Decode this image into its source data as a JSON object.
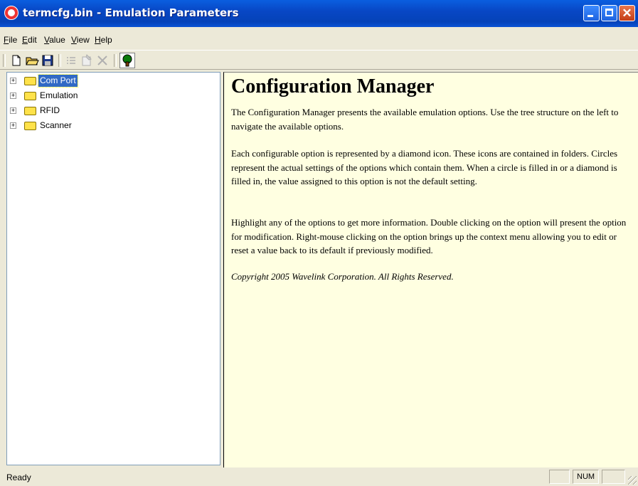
{
  "window": {
    "title": "termcfg.bin - Emulation Parameters",
    "close_glyph": "✕"
  },
  "menu": [
    "File",
    "Edit",
    "Value",
    "View",
    "Help"
  ],
  "toolbar": {
    "buttons": [
      "new-icon",
      "open-icon",
      "save-icon",
      "list-icon",
      "properties-icon",
      "delete-icon",
      "tree-icon"
    ]
  },
  "tree": {
    "expander_glyph": "+",
    "items": [
      {
        "label": "Com Port",
        "selected": true
      },
      {
        "label": "Emulation"
      },
      {
        "label": "RFID"
      },
      {
        "label": "Scanner"
      }
    ]
  },
  "content": {
    "heading": "Configuration Manager",
    "para1": "The Configuration Manager presents the available emulation options.  Use the tree structure on the left to navigate the available options.",
    "para2": "Each configurable option is represented by a diamond icon.  These icons are contained in folders.  Circles represent the actual settings of the options which contain them.  When a circle is filled in or a diamond is filled in, the value assigned to this option is not the default setting.",
    "para3": "Highlight any of the options to get more information.  Double clicking on the option will present the option for modification. Right-mouse clicking on the option brings up the context menu allowing you to edit or reset a value back to its default if previously modified.",
    "copyright": "Copyright 2005 Wavelink Corporation.  All Rights Reserved."
  },
  "status": {
    "text": "Ready",
    "pane1": "",
    "num": "NUM",
    "pane3": ""
  }
}
